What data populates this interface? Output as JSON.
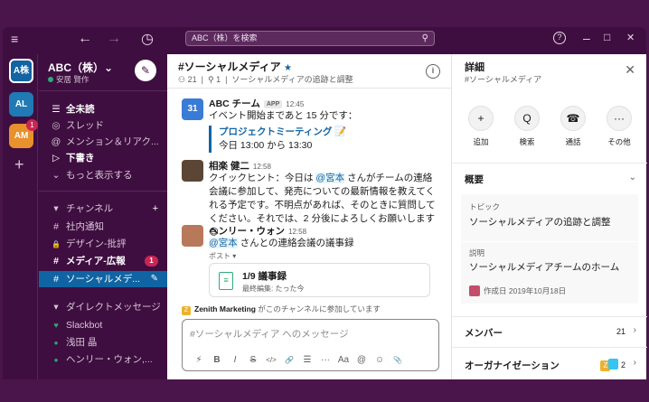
{
  "topbar": {
    "menu_icon": "≡",
    "back_icon": "←",
    "forward_icon": "→",
    "history_icon": "◷",
    "search_placeholder": "ABC（株）を検索",
    "help_icon": "?",
    "min_icon": "–",
    "max_icon": "□",
    "close_icon": "✕"
  },
  "rail": {
    "workspaces": [
      {
        "label": "A株",
        "color": "#1264a3"
      },
      {
        "label": "AL",
        "color": "#1f7ab6"
      },
      {
        "label": "AM",
        "color": "#e8912d",
        "badge": "1"
      }
    ],
    "add_label": "+"
  },
  "sidebar": {
    "team_name": "ABC（株）⌄",
    "user_name": "安居 賢作",
    "items": [
      {
        "icon": "☰",
        "label": "全未読",
        "bold": true
      },
      {
        "icon": "◎",
        "label": "スレッド"
      },
      {
        "icon": "@",
        "label": "メンション＆リアク..."
      },
      {
        "icon": "▷",
        "label": "下書き",
        "bold": true
      },
      {
        "icon": "⌄",
        "label": "もっと表示する"
      }
    ],
    "channels_header": "チャンネル",
    "channels": [
      {
        "icon": "#",
        "label": "社内通知"
      },
      {
        "icon": "🔒",
        "label": "デザイン-批評"
      },
      {
        "icon": "#",
        "label": "メディア-広報",
        "bold": true,
        "badge": "1"
      },
      {
        "icon": "#",
        "label": "ソーシャルメデ...",
        "active": true
      }
    ],
    "dm_header": "ダイレクトメッセージ",
    "dms": [
      {
        "icon": "♥",
        "label": "Slackbot"
      },
      {
        "icon": "●",
        "label": "浅田 晶"
      },
      {
        "icon": "●",
        "label": "ヘンリー・ウォン,..."
      }
    ]
  },
  "channel": {
    "name": "#ソーシャルメディア",
    "star": "★",
    "members": "21",
    "pins": "1",
    "topic": "ソーシャルメディアの追跡と調整"
  },
  "messages": {
    "m1": {
      "name": "ABC チーム",
      "app": "APP",
      "time": "12:45",
      "text": "イベント開始まであと 15 分です：",
      "quote_title": "プロジェクトミーティング 📝",
      "quote_text": "今日 13:00 から 13:30"
    },
    "m2": {
      "name": "相楽 健二",
      "time": "12:58",
      "text_a": "クイックヒント：今日は ",
      "mention": "@宮本",
      "text_b": " さんがチームの連絡会議に参加して、発売についての最新情報を教えてくれる予定です。不明点があれば、そのときに質問してください。それでは、2 分後によろしくお願いします 😄"
    },
    "m3": {
      "name": "ヘンリー・ウォン",
      "time": "12:58",
      "mention": "@宮本",
      "text": " さんとの連絡会議の議事録",
      "post_label": "ポスト ▾",
      "doc_title": "1/9 議事録",
      "doc_sub": "最終編集: たった今"
    },
    "joined_name": "Zenith Marketing",
    "joined_text": " がこのチャンネルに参加しています"
  },
  "composer": {
    "placeholder": "#ソーシャルメディア へのメッセージ",
    "tools": [
      "⚡",
      "B",
      "I",
      "S",
      "</>",
      "🔗",
      "☰",
      "···",
      "Aa",
      "@",
      "☺",
      "📎"
    ]
  },
  "details": {
    "title": "詳細",
    "subtitle": "#ソーシャルメディア",
    "actions": [
      {
        "icon": "+",
        "label": "追加"
      },
      {
        "icon": "Q",
        "label": "検索"
      },
      {
        "icon": "☎",
        "label": "通話"
      },
      {
        "icon": "···",
        "label": "その他"
      }
    ],
    "about_header": "概要",
    "topic_label": "トピック",
    "topic_value": "ソーシャルメディアの追跡と調整",
    "desc_label": "説明",
    "desc_value": "ソーシャルメディアチームのホーム",
    "created": "作成日 2019年10月18日",
    "members_header": "メンバー",
    "members_count": "21",
    "org_header": "オーガナイゼーション",
    "org_count": "2"
  }
}
